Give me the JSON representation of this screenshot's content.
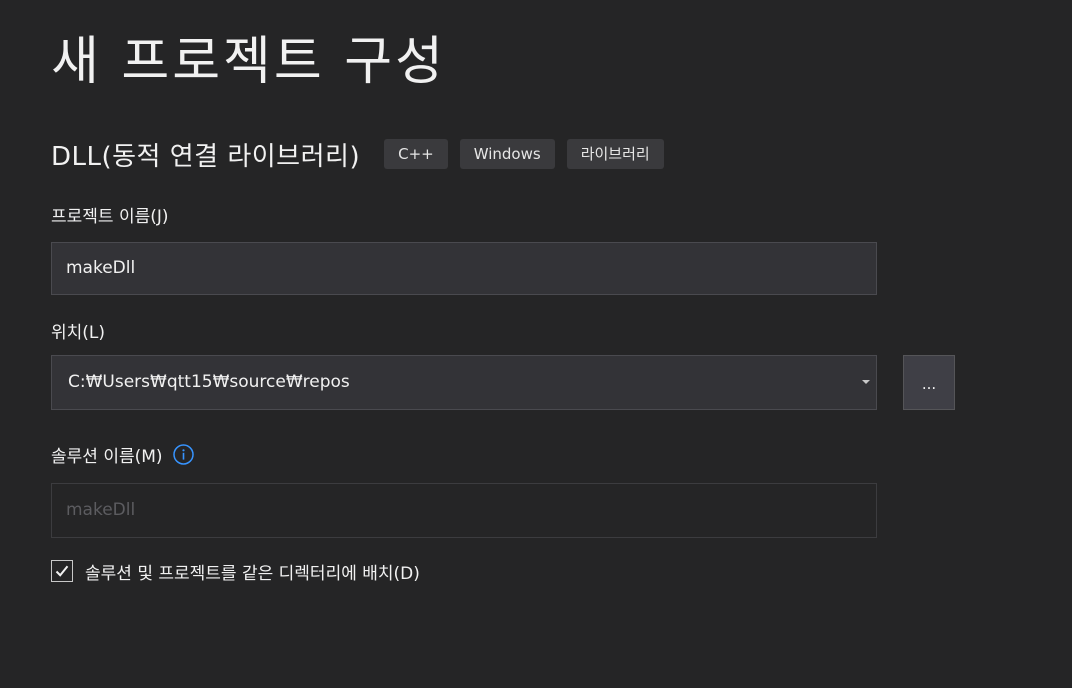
{
  "page_title": "새 프로젝트 구성",
  "template": {
    "name": "DLL(동적 연결 라이브러리)",
    "tags": [
      "C++",
      "Windows",
      "라이브러리"
    ]
  },
  "project_name": {
    "label": "프로젝트 이름(J)",
    "value": "makeDll"
  },
  "location": {
    "label": "위치(L)",
    "value": "C:₩Users₩qtt15₩source₩repos",
    "browse_label": "..."
  },
  "solution_name": {
    "label": "솔루션 이름(M)",
    "placeholder": "makeDll",
    "info_icon": "info-icon"
  },
  "same_directory": {
    "label": "솔루션 및 프로젝트를 같은 디렉터리에 배치(D)",
    "checked": true
  },
  "colors": {
    "background": "#252526",
    "input_bg": "#333337",
    "tag_bg": "#3a3a3d",
    "info_accent": "#3794ff"
  }
}
